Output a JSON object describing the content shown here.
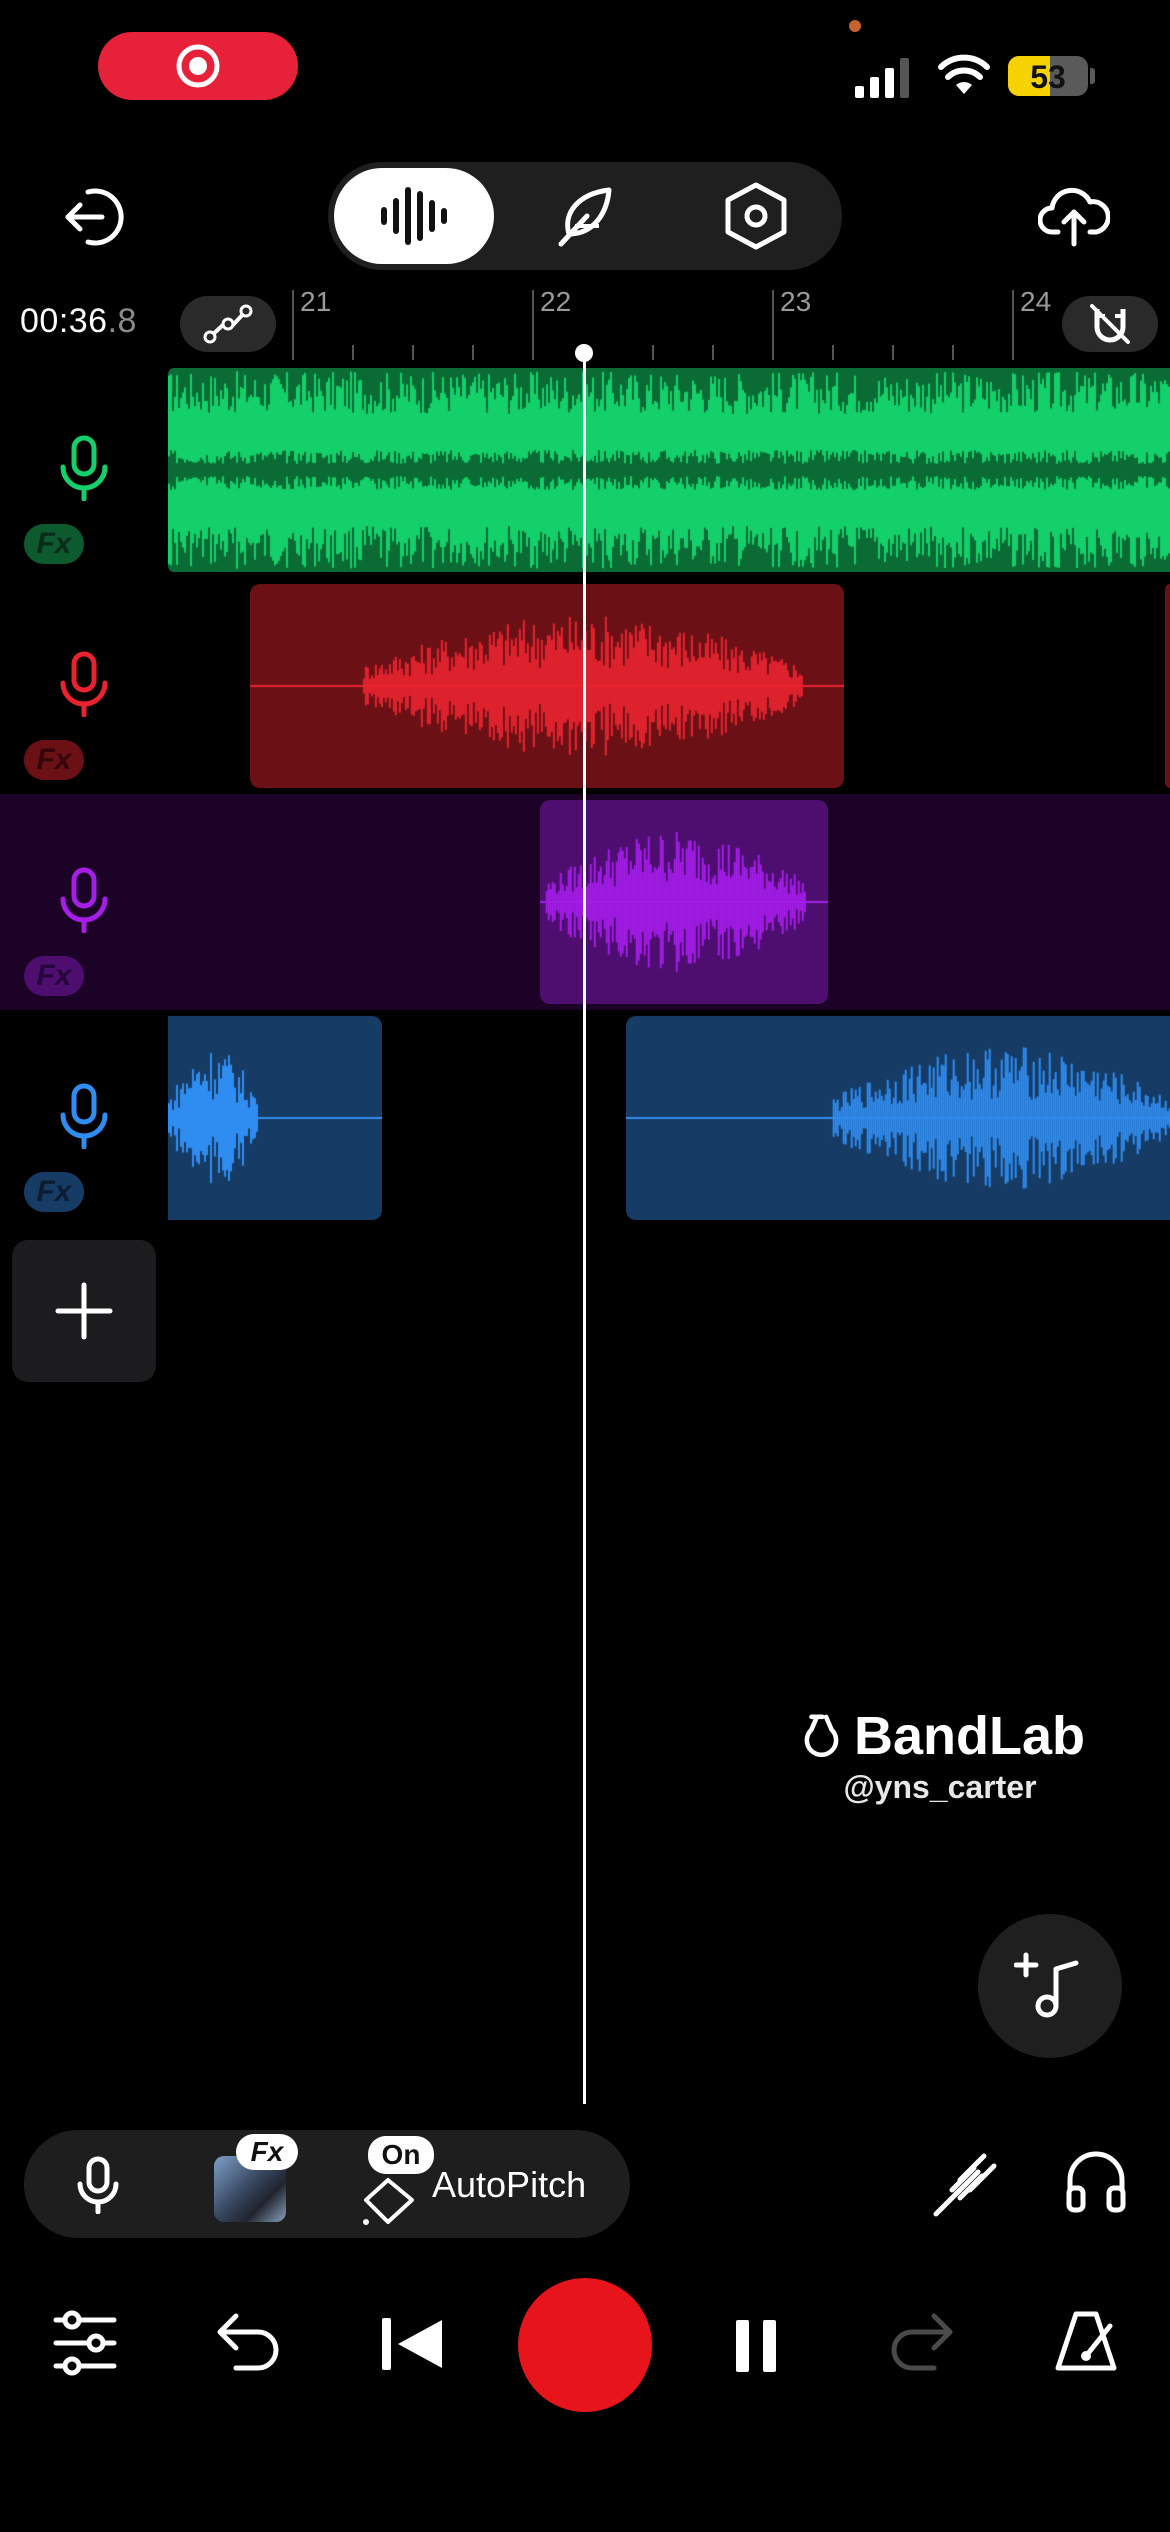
{
  "status_bar": {
    "battery_level": "53",
    "battery_fraction": 0.53
  },
  "toolbar": {
    "tabs": [
      {
        "id": "tracks",
        "icon": "waveform-icon",
        "active": true
      },
      {
        "id": "lyrics",
        "icon": "feather-icon",
        "active": false
      },
      {
        "id": "settings",
        "icon": "hexagon-settings-icon",
        "active": false
      }
    ]
  },
  "timeline": {
    "time_main": "00:36",
    "time_fraction": ".8",
    "ruler_labels": [
      "21",
      "22",
      "23",
      "24"
    ]
  },
  "tracks": [
    {
      "name": "track-1",
      "color": "#13d06a",
      "fx_bg": "#0e5a2f",
      "fx_fg": "#0a2c17",
      "fx_label": "Fx"
    },
    {
      "name": "track-2",
      "color": "#e8232f",
      "fx_bg": "#6b1116",
      "fx_fg": "#340609",
      "fx_label": "Fx"
    },
    {
      "name": "track-3",
      "color": "#a41ee6",
      "fx_bg": "#4d0e70",
      "fx_fg": "#26053a",
      "fx_label": "Fx"
    },
    {
      "name": "track-4",
      "color": "#2f8cf0",
      "fx_bg": "#163c66",
      "fx_fg": "#0a1d33",
      "fx_label": "Fx"
    }
  ],
  "branding": {
    "name": "BandLab",
    "username": "@yns_carter"
  },
  "bottom_bar": {
    "fx_badge": "Fx",
    "autopitch_badge": "On",
    "autopitch_label": "AutoPitch"
  },
  "colors": {
    "record_red": "#e8141c",
    "background": "#000000"
  }
}
